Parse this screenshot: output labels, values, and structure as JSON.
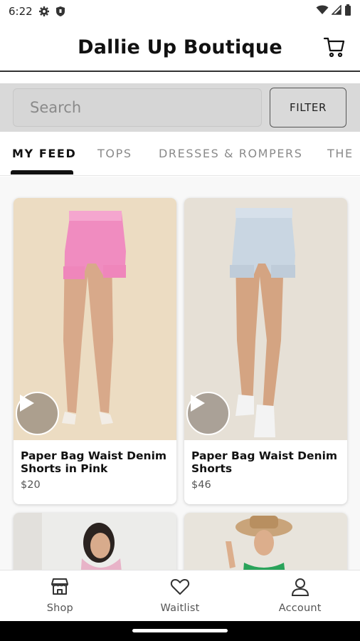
{
  "status_bar": {
    "time": "6:22"
  },
  "header": {
    "title": "Dallie Up Boutique",
    "cart_icon": "shopping-cart-icon"
  },
  "search": {
    "placeholder": "Search",
    "value": "",
    "filter_label": "FILTER"
  },
  "tabs": [
    {
      "label": "MY FEED",
      "active": true
    },
    {
      "label": "TOPS",
      "active": false
    },
    {
      "label": "DRESSES & ROMPERS",
      "active": false
    },
    {
      "label": "THE",
      "active": false
    }
  ],
  "products": [
    {
      "name": "Paper Bag Waist Denim Shorts in Pink",
      "price": "$20",
      "color": "#f08cc0",
      "has_video": true
    },
    {
      "name": "Paper Bag Waist Denim Shorts",
      "price": "$46",
      "color": "#c9d6e2",
      "has_video": true
    },
    {
      "name": "",
      "price": "",
      "color": "#e8b3c8",
      "has_video": false
    },
    {
      "name": "",
      "price": "",
      "color": "#2aa35a",
      "has_video": false
    }
  ],
  "bottom_nav": [
    {
      "label": "Shop",
      "icon": "storefront-icon"
    },
    {
      "label": "Waitlist",
      "icon": "heart-icon"
    },
    {
      "label": "Account",
      "icon": "user-icon"
    }
  ],
  "colors": {
    "accent": "#111111",
    "search_bar_bg": "#d9d9d9",
    "photo_bg": "#e9e2d6"
  }
}
